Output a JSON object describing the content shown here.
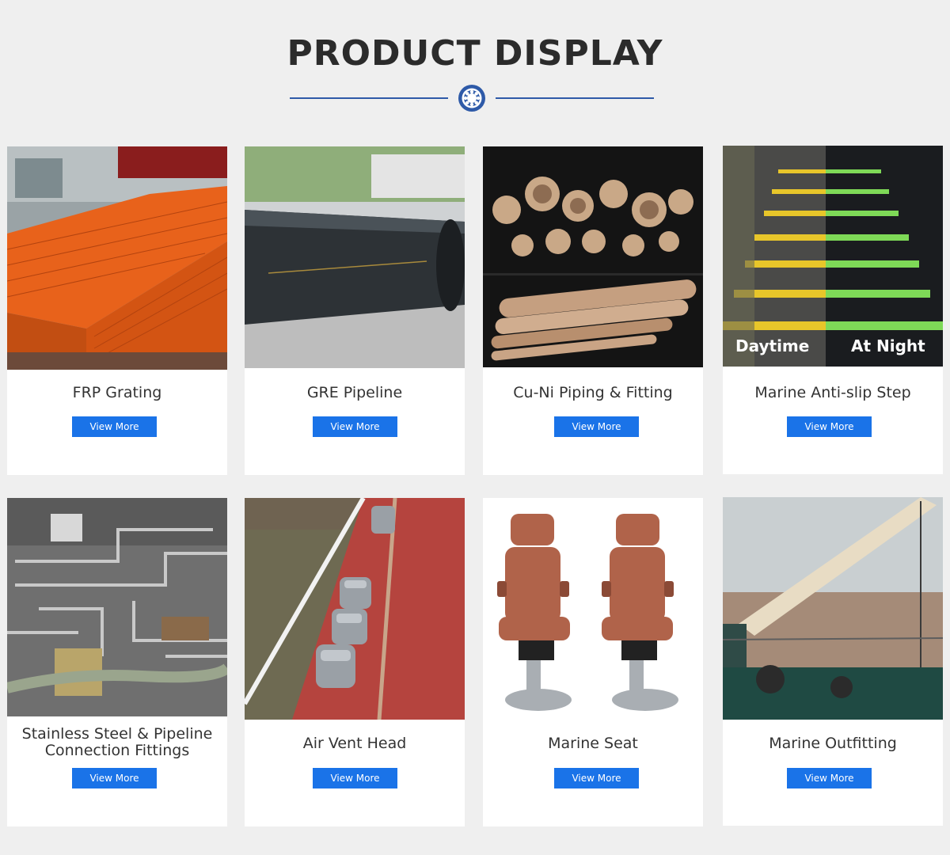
{
  "header": {
    "title": "PRODUCT DISPLAY"
  },
  "products": [
    {
      "name": "FRP Grating",
      "button": "View More"
    },
    {
      "name": "GRE Pipeline",
      "button": "View More"
    },
    {
      "name": "Cu-Ni  Piping & Fitting",
      "button": "View More"
    },
    {
      "name": "Marine Anti-slip Step",
      "button": "View More",
      "overlay": {
        "left": "Daytime",
        "right": "At  Night"
      }
    },
    {
      "name_lines": [
        "Stainless Steel & Pipeline",
        "Connection Fittings"
      ],
      "button": "View More"
    },
    {
      "name": "Air Vent Head",
      "button": "View More"
    },
    {
      "name": "Marine Seat",
      "button": "View More"
    },
    {
      "name": "Marine Outfitting",
      "button": "View More"
    }
  ],
  "colors": {
    "accent": "#1a73e8",
    "divider": "#2e5aa8",
    "background": "#efefef"
  },
  "icons": {
    "divider": "bearing-emblem-icon"
  }
}
